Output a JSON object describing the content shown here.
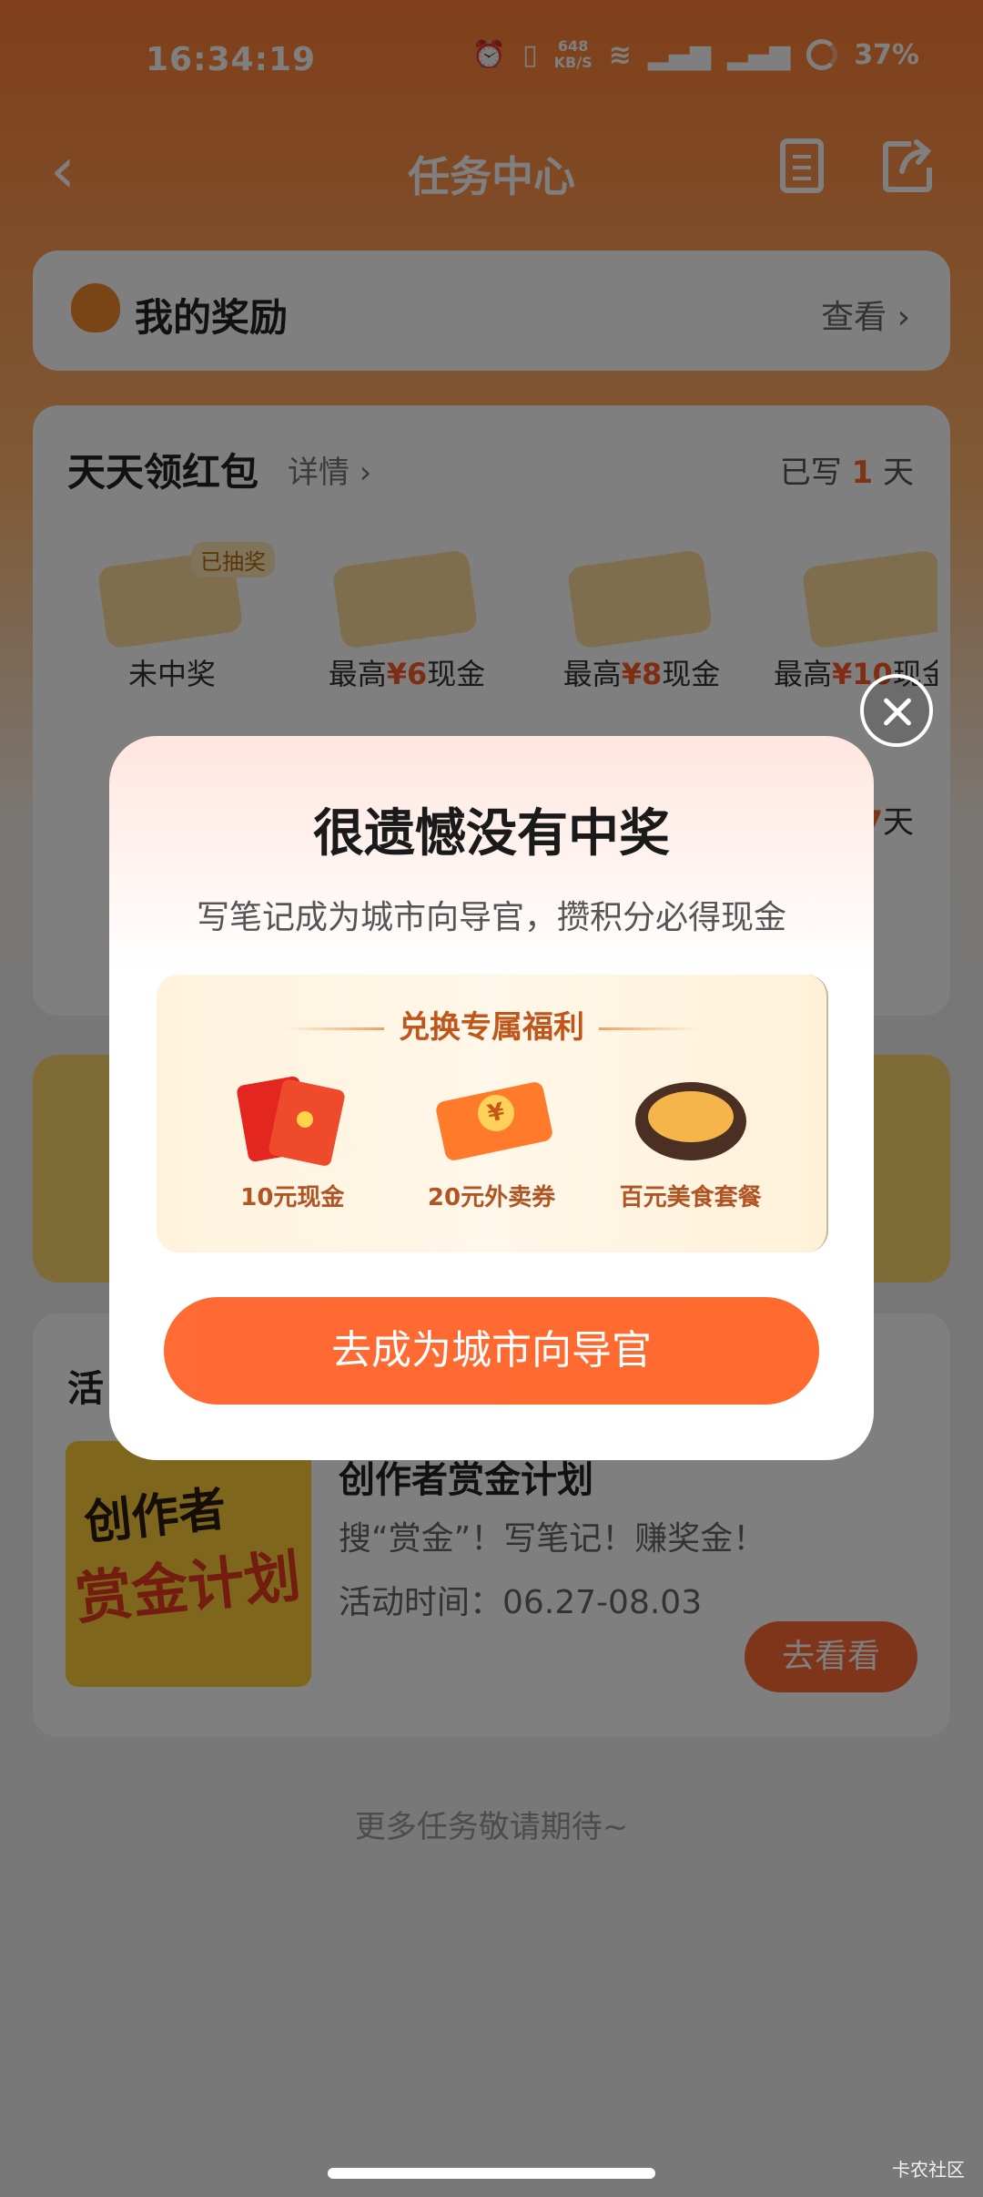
{
  "status_bar": {
    "time": "16:34:19",
    "net_speed": "648",
    "net_unit": "KB/S",
    "battery": "37%",
    "icons": [
      "alarm-icon",
      "vibrate-icon",
      "wifi-icon",
      "signal-5g-icon",
      "signal-5g-icon",
      "battery-icon"
    ]
  },
  "nav": {
    "title": "任务中心",
    "back_icon": "back-arrow-icon",
    "doc_icon": "document-icon",
    "share_icon": "share-icon"
  },
  "reward": {
    "title": "我的奖励",
    "link": "查看 ›"
  },
  "daily": {
    "title": "天天领红包",
    "detail": "详情 ›",
    "written_prefix": "已写 ",
    "written_days": "1",
    "written_suffix": " 天",
    "draws": [
      {
        "badge": "已抽奖",
        "label": "未中奖"
      },
      {
        "prefix": "最高",
        "amount": "¥6",
        "suffix": "现金"
      },
      {
        "prefix": "最高",
        "amount": "¥8",
        "suffix": "现金"
      },
      {
        "prefix": "最高",
        "amount": "¥10",
        "suffix": "现金"
      }
    ],
    "rest_days": "7",
    "rest_suffix": "天"
  },
  "activity": {
    "heading": "活",
    "thumb_line1": "创作者",
    "thumb_line2": "赏金计划",
    "name": "创作者赏金计划",
    "desc": "搜“赏金”！写笔记！赚奖金！",
    "time": "活动时间：06.27-08.03",
    "button": "去看看"
  },
  "more_tasks": "更多任务敬请期待~",
  "dialog": {
    "title": "很遗憾没有中奖",
    "subtitle": "写笔记成为城市向导官，攒积分必得现金",
    "benefit_heading": "兑换专属福利",
    "benefits": [
      {
        "label": "10元现金",
        "icon": "red-envelope-icon"
      },
      {
        "label": "20元外卖券",
        "icon": "coupon-icon"
      },
      {
        "label": "百元美食套餐",
        "icon": "food-bowl-icon"
      }
    ],
    "cta": "去成为城市向导官"
  },
  "watermark": "卡农社区",
  "colors": {
    "accent": "#ff6a35",
    "header_gradient_top": "#ff7f35",
    "benefit_text": "#b05424"
  }
}
